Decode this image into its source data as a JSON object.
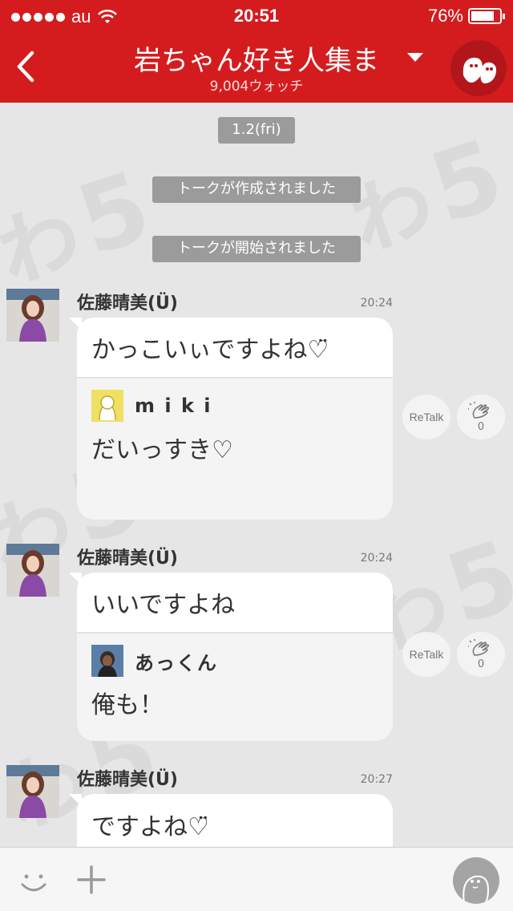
{
  "status_bar": {
    "carrier": "au",
    "time": "20:51",
    "battery": "76%"
  },
  "header": {
    "title": "岩ちゃん好き人集ま",
    "subtitle": "9,004ウォッチ",
    "back_icon": "chevron-left-icon",
    "dropdown_icon": "caret-down-icon",
    "avatar_icon": "ghost-mascot-icon"
  },
  "chat": {
    "date_label": "1.2(fri)",
    "system_messages": [
      "トークが作成されました",
      "トークが開始されました"
    ],
    "messages": [
      {
        "sender": "佐藤晴美(Ü)",
        "time": "20:24",
        "text": "かっこいぃですよね♡̈",
        "reply": {
          "user": "m i k i",
          "text": "だいっすき♡"
        },
        "retalk_label": "ReTalk",
        "clap_count": "0"
      },
      {
        "sender": "佐藤晴美(Ü)",
        "time": "20:24",
        "text": "いいですよね",
        "reply": {
          "user": "あっくん",
          "text": "俺も！"
        },
        "retalk_label": "ReTalk",
        "clap_count": "0"
      },
      {
        "sender": "佐藤晴美(Ü)",
        "time": "20:27",
        "text": "ですよね♡̈"
      }
    ]
  },
  "bottom_bar": {
    "emoji_icon": "smiley-icon",
    "add_icon": "plus-icon",
    "profile_icon": "profile-ghost-icon"
  },
  "colors": {
    "header_red": "#d41c1f",
    "background": "#e6e6e6",
    "system_label_gray": "#9b9b9b"
  }
}
